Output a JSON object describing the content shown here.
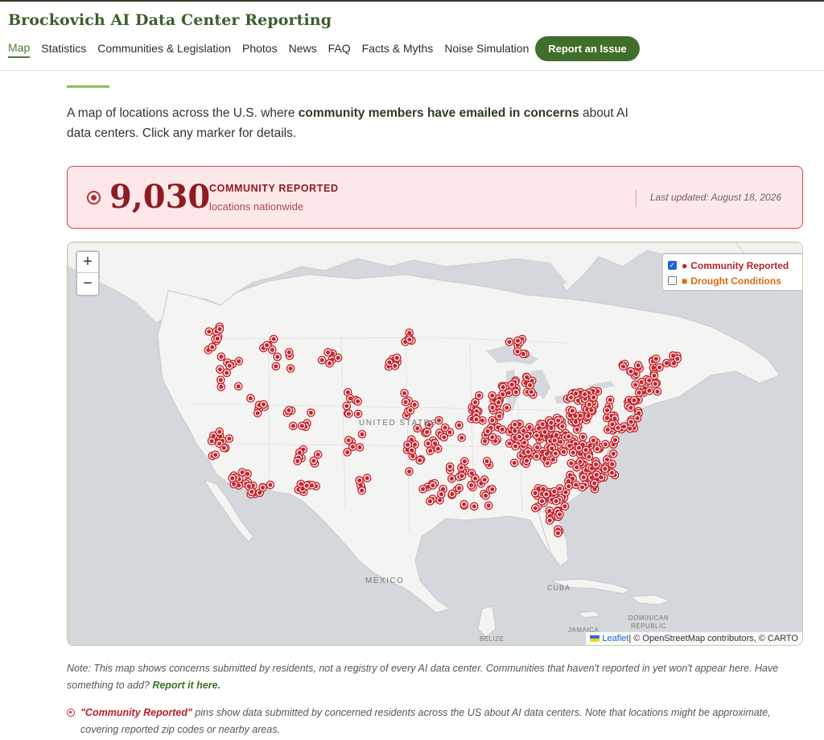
{
  "site": {
    "title": "Brockovich AI Data Center Reporting",
    "nav": [
      "Map",
      "Statistics",
      "Communities & Legislation",
      "Photos",
      "News",
      "FAQ",
      "Facts & Myths",
      "Noise Simulation"
    ],
    "active_nav": "Map",
    "report_button": "Report an Issue"
  },
  "intro": {
    "before": "A map of locations across the U.S. where ",
    "bold": "community members have emailed in concerns",
    "after": " about AI data centers. Click any marker for details."
  },
  "stats": {
    "count": "9,030",
    "label": "COMMUNITY REPORTED",
    "sublabel": "locations nationwide",
    "updated": "Last updated: August 18, 2026"
  },
  "map": {
    "zoom_in": "+",
    "zoom_out": "−",
    "place_labels": [
      "UNITED STATES",
      "MEXICO",
      "CUBA",
      "DOMINICAN REPUBLIC",
      "JAMAICA",
      "BELIZE"
    ],
    "legend": [
      {
        "label": "Community Reported",
        "checked": true,
        "color": "#b5202a"
      },
      {
        "label": "Drought Conditions",
        "checked": false,
        "color": "#d86a10"
      }
    ],
    "attribution": {
      "leaflet": "Leaflet",
      "rest": " | © OpenStreetMap contributors, © CARTO"
    },
    "marker_color": "#c4262f"
  },
  "notes": {
    "disclaimer": "Note: This map shows concerns submitted by residents, not a registry of every AI data center. Communities that haven't reported in yet won't appear here. Have something to add? ",
    "disclaimer_link": "Report it here.",
    "legend_term": "\"Community Reported\"",
    "legend_text": " pins show data submitted by concerned residents across the US about AI data centers. Note that locations might be approximate, covering reported zip codes or nearby areas."
  }
}
